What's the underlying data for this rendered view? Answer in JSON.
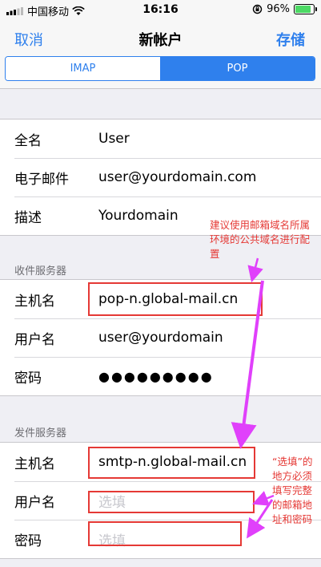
{
  "status_bar": {
    "carrier": "中国移动",
    "time": "16:16",
    "battery_percent": "96%",
    "battery_level": 0.96,
    "icons": [
      "signal-bars-icon",
      "wifi-icon",
      "orientation-lock-icon",
      "battery-icon"
    ]
  },
  "nav": {
    "cancel_label": "取消",
    "title": "新帐户",
    "save_label": "存储"
  },
  "segmented": {
    "imap_label": "IMAP",
    "pop_label": "POP",
    "selected": "POP"
  },
  "account": {
    "name_label": "全名",
    "name_value": "User",
    "email_label": "电子邮件",
    "email_value": "user@yourdomain.com",
    "desc_label": "描述",
    "desc_value": "Yourdomain"
  },
  "incoming": {
    "header": "收件服务器",
    "host_label": "主机名",
    "host_value": "pop-n.global-mail.cn",
    "user_label": "用户名",
    "user_value": "user@yourdomain",
    "password_label": "密码",
    "password_value": "●●●●●●●●●"
  },
  "outgoing": {
    "header": "发件服务器",
    "host_label": "主机名",
    "host_value": "smtp-n.global-mail.cn",
    "user_label": "用户名",
    "user_placeholder": "选填",
    "password_label": "密码",
    "password_placeholder": "选填"
  },
  "annotations": {
    "note_top": "建议使用邮箱域名所属环境的公共域名进行配置",
    "note_bottom": "“选填”的地方必须填写完整的邮箱地址和密码",
    "color_red": "#e53935",
    "color_arrow": "#e040fb"
  },
  "colors": {
    "accent": "#2f80ed",
    "background": "#efeff4"
  }
}
